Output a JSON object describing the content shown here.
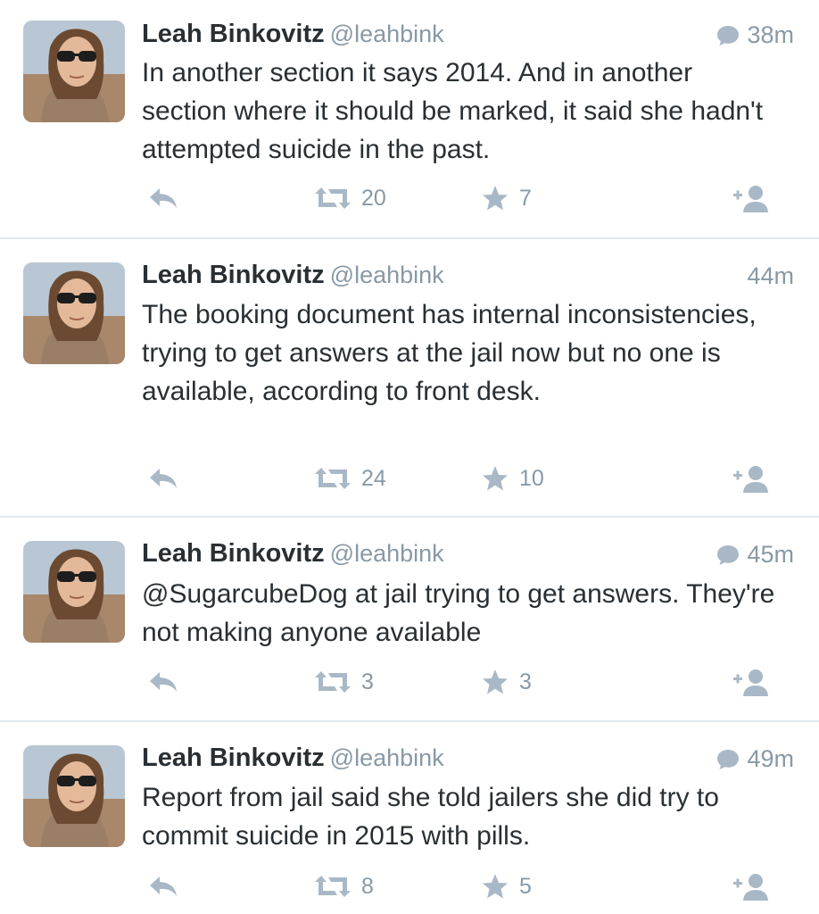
{
  "colors": {
    "text": "#292f33",
    "muted": "#8899a6",
    "divider": "#e1e8ed",
    "icon": "#a9b8c6"
  },
  "icons": {
    "reply": "reply-icon",
    "retweet": "retweet-icon",
    "favorite": "star-icon",
    "follow": "add-user-icon",
    "conversation": "speech-bubble-icon"
  },
  "tweets": [
    {
      "name": "Leah Binkovitz",
      "handle": "@leahbink",
      "time": "38m",
      "has_conversation": true,
      "text": "In another section it says 2014. And in another section where it should be marked, it said she hadn't attempted suicide in the past.",
      "retweets": "20",
      "favorites": "7"
    },
    {
      "name": "Leah Binkovitz",
      "handle": "@leahbink",
      "time": "44m",
      "has_conversation": false,
      "text": "The booking document has internal inconsistencies, trying to get answers at the jail now but no one is available, according to front desk.",
      "retweets": "24",
      "favorites": "10"
    },
    {
      "name": "Leah Binkovitz",
      "handle": "@leahbink",
      "time": "45m",
      "has_conversation": true,
      "text": "@SugarcubeDog at jail trying to get answers. They're not making anyone available",
      "retweets": "3",
      "favorites": "3"
    },
    {
      "name": "Leah Binkovitz",
      "handle": "@leahbink",
      "time": "49m",
      "has_conversation": true,
      "text": "Report from jail said she told jailers she did try to commit suicide in 2015 with pills.",
      "retweets": "8",
      "favorites": "5"
    }
  ]
}
